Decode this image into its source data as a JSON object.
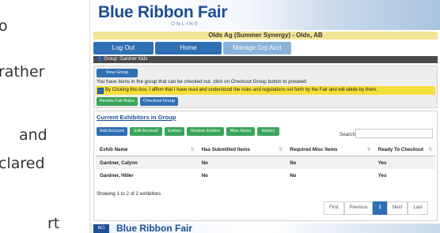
{
  "slide_fragments": [
    "o",
    "rather",
    "and",
    "clared",
    "rt"
  ],
  "app": {
    "logo": "Blue Ribbon Fair",
    "logo_sub": "ONLINE",
    "context_title": "Olds Ag (Summer Synergy) - Olds, AB"
  },
  "nav": {
    "logout": "Log Out",
    "home": "Home",
    "manage": "Manage Grp Acct"
  },
  "group_label": "Group: Gardner Kids",
  "panel": {
    "view_summary": "View Group Summary",
    "message": "You have items in the group that can be checked out. click on Checkout Group button to proceed:",
    "agree_text": "By Clicking this box, I affirm that I have read and understood the rules and regulations set forth by the Fair and will abide by them.",
    "agree_checked": true,
    "review_rules": "Review Fair Rules",
    "checkout": "Checkout Group"
  },
  "section": {
    "title": "Current Exhibitors in Group",
    "buttons": [
      "Add Account",
      "Edit Account",
      "Entries",
      "Review Entries",
      "Misc Items",
      "History"
    ],
    "search_label": "Search:",
    "search_value": "",
    "columns": [
      "Exhib Name",
      "Has Submitted Items",
      "Required Misc Items",
      "Ready To Checkout"
    ],
    "rows": [
      [
        "Gardner, Calynn",
        "No",
        "No",
        "Yes"
      ],
      [
        "Gardner, Hiller",
        "No",
        "No",
        "Yes"
      ]
    ],
    "info": "Showing 1 to 2 of 2 exhibitors",
    "pager": {
      "first": "First",
      "previous": "Previous",
      "current": "1",
      "next": "Next",
      "last": "Last"
    }
  },
  "footer": {
    "logo": "Blue Ribbon Fair",
    "badge": "BCI"
  },
  "colors": {
    "primary": "#2f6fb4",
    "success": "#3aa55a",
    "title_bg": "#f3e493",
    "agree_bg": "#f4e03a"
  }
}
